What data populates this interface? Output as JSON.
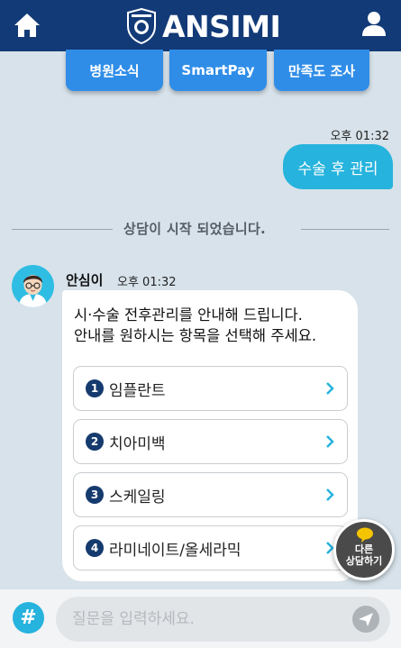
{
  "header": {
    "brand": "ANSIMI",
    "home_icon": "home-icon",
    "user_icon": "user-icon",
    "bg_color": "#123a77"
  },
  "quick_menu": [
    {
      "label": "병원소식"
    },
    {
      "label": "SmartPay"
    },
    {
      "label": "만족도 조사"
    }
  ],
  "chat": {
    "user_message": {
      "time": "오후 01:32",
      "text": "수술 후 관리"
    },
    "divider_text": "상담이 시작 되었습니다.",
    "bot": {
      "name": "안심이",
      "time": "오후 01:32",
      "message_line1": "시·수술 전후관리를 안내해 드립니다.",
      "message_line2": "안내를 원하시는 항목을 선택해 주세요.",
      "options": [
        {
          "num": "1",
          "label": "임플란트"
        },
        {
          "num": "2",
          "label": "치아미백"
        },
        {
          "num": "3",
          "label": "스케일링"
        },
        {
          "num": "4",
          "label": "라미네이트/올세라믹"
        }
      ]
    }
  },
  "floating": {
    "line1": "다른",
    "line2": "상담하기"
  },
  "composer": {
    "hash_label": "#",
    "placeholder": "질문을 입력하세요.",
    "send_icon": "send-icon"
  },
  "colors": {
    "accent": "#2f8de8",
    "user_bubble": "#26b3dd",
    "bg": "#d7e2ea"
  }
}
